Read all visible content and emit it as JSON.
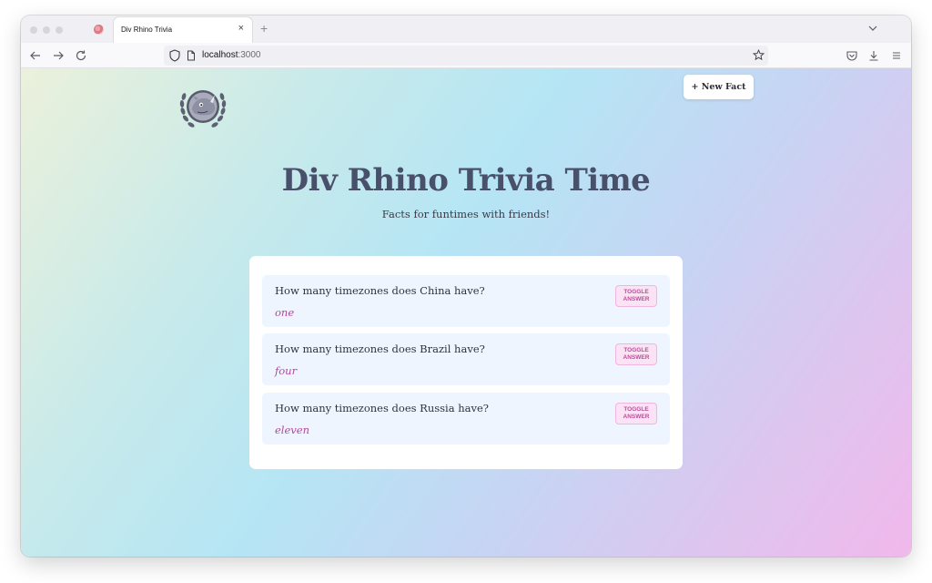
{
  "browser": {
    "tab": {
      "title": "Div Rhino Trivia",
      "close_glyph": "×"
    },
    "new_tab_glyph": "+",
    "url": {
      "host": "localhost",
      "port": ":3000"
    }
  },
  "header": {
    "new_fact_label": "+ New Fact",
    "title": "Div Rhino Trivia Time",
    "subtitle": "Facts for funtimes with friends!"
  },
  "facts": [
    {
      "question": "How many timezones does China have?",
      "answer": "one",
      "toggle_label": "TOGGLE\nANSWER"
    },
    {
      "question": "How many timezones does Brazil have?",
      "answer": "four",
      "toggle_label": "TOGGLE\nANSWER"
    },
    {
      "question": "How many timezones does Russia have?",
      "answer": "eleven",
      "toggle_label": "TOGGLE\nANSWER"
    }
  ],
  "colors": {
    "accent_pink": "#b2489b",
    "title_color": "#49506a",
    "fact_bg": "#eef5ff"
  }
}
